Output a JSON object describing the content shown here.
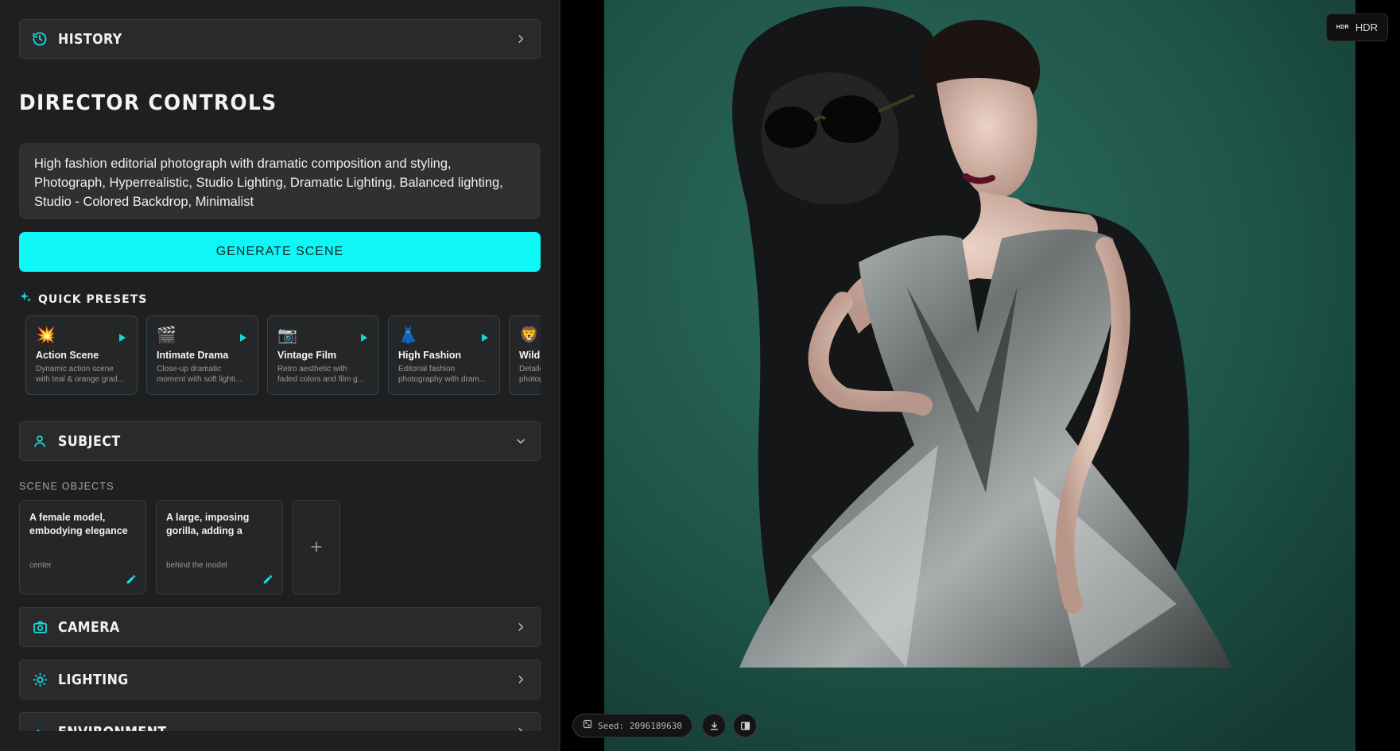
{
  "sidebar": {
    "history": {
      "label": "HISTORY",
      "icon": "history-icon"
    },
    "title": "DIRECTOR CONTROLS",
    "prompt": "High fashion editorial photograph with dramatic composition and styling, Photograph, Hyperrealistic, Studio Lighting, Dramatic Lighting, Balanced lighting, Studio - Colored Backdrop, Minimalist",
    "generate_label": "GENERATE SCENE",
    "quick_presets": {
      "label": "QUICK PRESETS",
      "items": [
        {
          "emoji": "💥",
          "name": "Action Scene",
          "desc": "Dynamic action scene with teal & orange grad..."
        },
        {
          "emoji": "🎬",
          "name": "Intimate Drama",
          "desc": "Close-up dramatic moment with soft lighti..."
        },
        {
          "emoji": "📷",
          "name": "Vintage Film",
          "desc": "Retro aesthetic with faded colors and film g..."
        },
        {
          "emoji": "👗",
          "name": "High Fashion",
          "desc": "Editorial fashion photography with dram..."
        },
        {
          "emoji": "🦁",
          "name": "Wildlife",
          "desc": "Detailed wildlife photography..."
        }
      ]
    },
    "subject": {
      "label": "SUBJECT"
    },
    "scene_objects": {
      "label": "SCENE OBJECTS",
      "items": [
        {
          "title": "A female model, embodying elegance a...",
          "position": "center"
        },
        {
          "title": "A large, imposing gorilla, adding a surre...",
          "position": "behind the model"
        }
      ],
      "add_label": "+"
    },
    "camera": {
      "label": "CAMERA"
    },
    "lighting": {
      "label": "LIGHTING"
    },
    "environment": {
      "label": "ENVIRONMENT"
    }
  },
  "viewer": {
    "hdr_badge": {
      "icon_text": "HDR",
      "label": "HDR"
    },
    "seed_label": "Seed: 2096189630",
    "image_alt": "Fashion model in metallic origami gown posing in front of a gorilla wearing sunglasses, teal backdrop"
  },
  "colors": {
    "accent": "#0ef6f6",
    "panel_bg": "#1f1f21",
    "backdrop": "#1f5548"
  }
}
